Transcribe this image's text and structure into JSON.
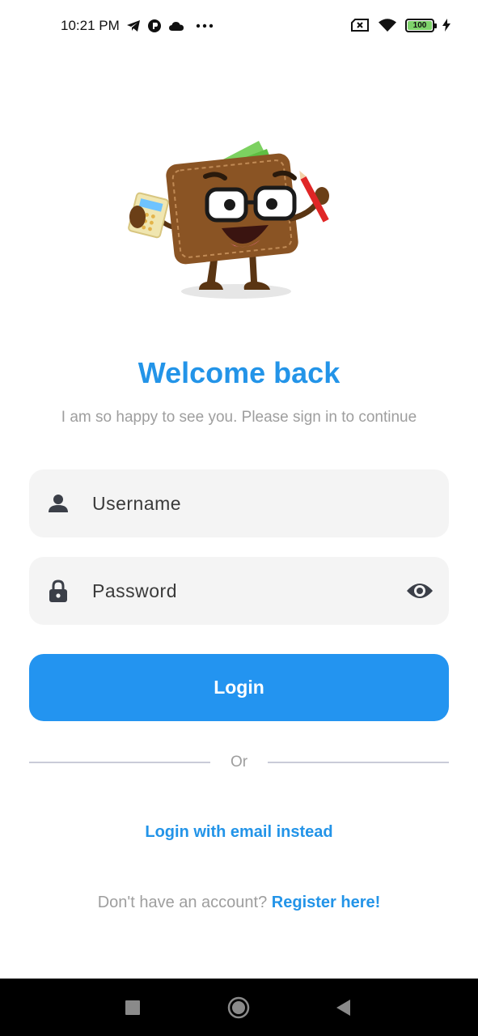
{
  "status_bar": {
    "time": "10:21 PM",
    "left_icons": [
      "telegram-icon",
      "notification-app-icon",
      "cloud-icon",
      "more-dots-icon"
    ],
    "right_icons": [
      "no-sim-icon",
      "wifi-icon",
      "battery-icon",
      "charging-icon"
    ],
    "battery_level": "100"
  },
  "illustration": "wallet-mascot-with-calculator-and-pencil",
  "header": {
    "title": "Welcome back",
    "subtitle": "I am so happy to see you. Please sign in to continue"
  },
  "form": {
    "username": {
      "placeholder": "Username",
      "value": "",
      "icon": "person-icon"
    },
    "password": {
      "placeholder": "Password",
      "value": "",
      "icon": "lock-icon",
      "toggle_icon": "eye-icon"
    },
    "login_label": "Login"
  },
  "divider": {
    "label": "Or"
  },
  "alt_login": {
    "label": "Login with email instead"
  },
  "register": {
    "prompt": "Don't have an account?",
    "link_label": "Register here!"
  },
  "nav_bar": {
    "buttons": [
      "recents-square-icon",
      "home-circle-icon",
      "back-triangle-icon"
    ]
  },
  "colors": {
    "accent": "#2394e8",
    "field_background": "#f4f4f4",
    "muted_text": "#9e9e9e"
  }
}
